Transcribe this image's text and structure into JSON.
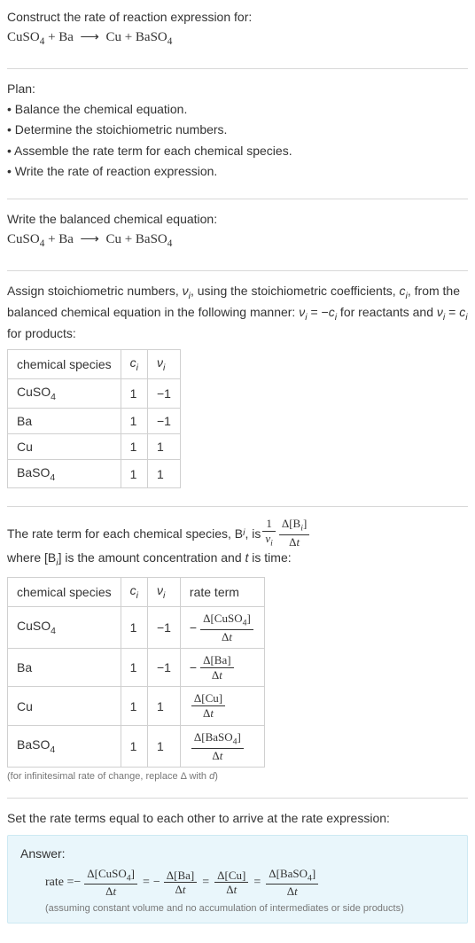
{
  "intro": {
    "title": "Construct the rate of reaction expression for:",
    "equation_html": "CuSO<sub>4</sub> + Ba &nbsp;⟶&nbsp; Cu + BaSO<sub>4</sub>"
  },
  "plan": {
    "heading": "Plan:",
    "items": [
      "Balance the chemical equation.",
      "Determine the stoichiometric numbers.",
      "Assemble the rate term for each chemical species.",
      "Write the rate of reaction expression."
    ]
  },
  "balanced": {
    "heading": "Write the balanced chemical equation:",
    "equation_html": "CuSO<sub>4</sub> + Ba &nbsp;⟶&nbsp; Cu + BaSO<sub>4</sub>"
  },
  "stoich": {
    "intro_html": "Assign stoichiometric numbers, <span class=\"italic\">ν<sub>i</sub></span>, using the stoichiometric coefficients, <span class=\"italic\">c<sub>i</sub></span>, from the balanced chemical equation in the following manner: <span class=\"italic\">ν<sub>i</sub></span> = −<span class=\"italic\">c<sub>i</sub></span> for reactants and <span class=\"italic\">ν<sub>i</sub></span> = <span class=\"italic\">c<sub>i</sub></span> for products:",
    "headers": {
      "species": "chemical species",
      "ci_html": "<span class=\"italic\">c<sub>i</sub></span>",
      "vi_html": "<span class=\"italic\">ν<sub>i</sub></span>"
    },
    "rows": [
      {
        "species_html": "CuSO<sub>4</sub>",
        "ci": "1",
        "vi": "−1"
      },
      {
        "species_html": "Ba",
        "ci": "1",
        "vi": "−1"
      },
      {
        "species_html": "Cu",
        "ci": "1",
        "vi": "1"
      },
      {
        "species_html": "BaSO<sub>4</sub>",
        "ci": "1",
        "vi": "1"
      }
    ]
  },
  "rateterm": {
    "intro_prefix": "The rate term for each chemical species, B",
    "intro_middle": ", is ",
    "frac1_num_html": "1",
    "frac1_den_html": "<span class=\"italic\">ν<sub>i</sub></span>",
    "frac2_num_html": "Δ[B<sub><span class=\"italic\">i</span></sub>]",
    "frac2_den_html": "Δ<span class=\"italic\">t</span>",
    "intro_suffix_html": " where [B<sub><span class=\"italic\">i</span></sub>] is the amount concentration and <span class=\"italic\">t</span> is time:",
    "headers": {
      "species": "chemical species",
      "ci_html": "<span class=\"italic\">c<sub>i</sub></span>",
      "vi_html": "<span class=\"italic\">ν<sub>i</sub></span>",
      "rate": "rate term"
    },
    "rows": [
      {
        "species_html": "CuSO<sub>4</sub>",
        "ci": "1",
        "vi": "−1",
        "neg": true,
        "num_html": "Δ[CuSO<sub>4</sub>]",
        "den_html": "Δ<span class=\"italic\">t</span>"
      },
      {
        "species_html": "Ba",
        "ci": "1",
        "vi": "−1",
        "neg": true,
        "num_html": "Δ[Ba]",
        "den_html": "Δ<span class=\"italic\">t</span>"
      },
      {
        "species_html": "Cu",
        "ci": "1",
        "vi": "1",
        "neg": false,
        "num_html": "Δ[Cu]",
        "den_html": "Δ<span class=\"italic\">t</span>"
      },
      {
        "species_html": "BaSO<sub>4</sub>",
        "ci": "1",
        "vi": "1",
        "neg": false,
        "num_html": "Δ[BaSO<sub>4</sub>]",
        "den_html": "Δ<span class=\"italic\">t</span>"
      }
    ],
    "note_html": "(for infinitesimal rate of change, replace Δ with <span class=\"italic\">d</span>)"
  },
  "final": {
    "heading": "Set the rate terms equal to each other to arrive at the rate expression:"
  },
  "answer": {
    "label": "Answer:",
    "rate_label": "rate = ",
    "terms": [
      {
        "neg": true,
        "num_html": "Δ[CuSO<sub>4</sub>]",
        "den_html": "Δ<span class=\"italic\">t</span>"
      },
      {
        "neg": true,
        "num_html": "Δ[Ba]",
        "den_html": "Δ<span class=\"italic\">t</span>"
      },
      {
        "neg": false,
        "num_html": "Δ[Cu]",
        "den_html": "Δ<span class=\"italic\">t</span>"
      },
      {
        "neg": false,
        "num_html": "Δ[BaSO<sub>4</sub>]",
        "den_html": "Δ<span class=\"italic\">t</span>"
      }
    ],
    "note": "(assuming constant volume and no accumulation of intermediates or side products)"
  },
  "chart_data": {
    "type": "table",
    "tables": [
      {
        "title": "Stoichiometric numbers",
        "columns": [
          "chemical species",
          "c_i",
          "ν_i"
        ],
        "rows": [
          [
            "CuSO4",
            1,
            -1
          ],
          [
            "Ba",
            1,
            -1
          ],
          [
            "Cu",
            1,
            1
          ],
          [
            "BaSO4",
            1,
            1
          ]
        ]
      },
      {
        "title": "Rate terms",
        "columns": [
          "chemical species",
          "c_i",
          "ν_i",
          "rate term"
        ],
        "rows": [
          [
            "CuSO4",
            1,
            -1,
            "-Δ[CuSO4]/Δt"
          ],
          [
            "Ba",
            1,
            -1,
            "-Δ[Ba]/Δt"
          ],
          [
            "Cu",
            1,
            1,
            "Δ[Cu]/Δt"
          ],
          [
            "BaSO4",
            1,
            1,
            "Δ[BaSO4]/Δt"
          ]
        ]
      }
    ],
    "rate_expression": "rate = -Δ[CuSO4]/Δt = -Δ[Ba]/Δt = Δ[Cu]/Δt = Δ[BaSO4]/Δt"
  }
}
